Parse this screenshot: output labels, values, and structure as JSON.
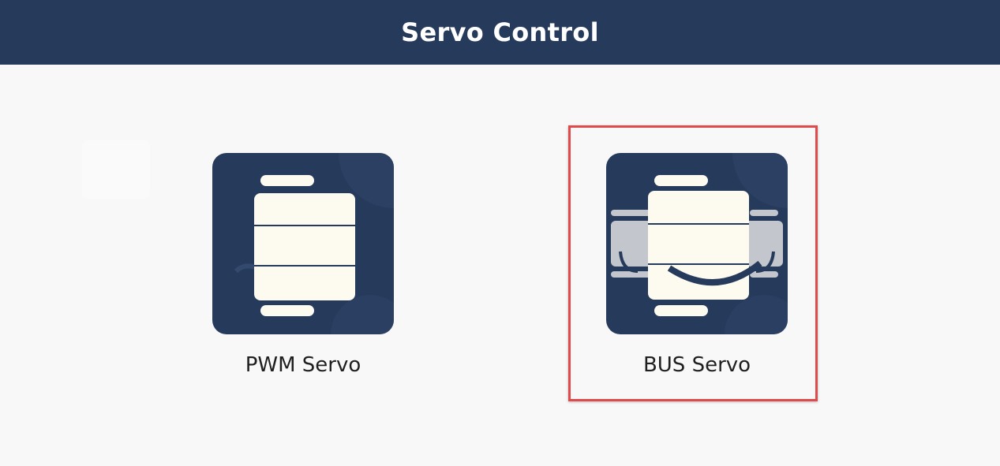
{
  "header": {
    "title": "Servo Control"
  },
  "tiles": [
    {
      "label": "PWM Servo",
      "icon": "pwm-servo-icon",
      "selected": false
    },
    {
      "label": "BUS Servo",
      "icon": "bus-servo-icon",
      "selected": true
    }
  ],
  "colors": {
    "header_bg": "#263a5c",
    "icon_bg": "#263a5c",
    "icon_fg": "#fdfaf0",
    "selection_border": "#e04a4a",
    "page_bg": "#f8f8f8"
  }
}
